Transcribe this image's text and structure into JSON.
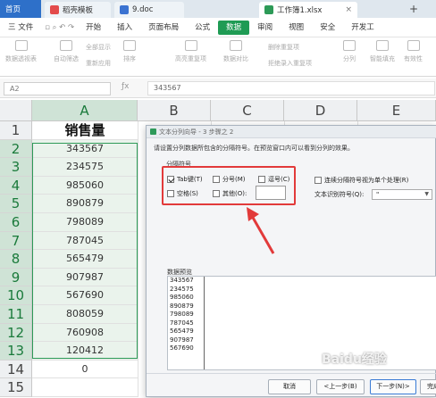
{
  "tabs": {
    "home": "首页",
    "templates": "稻壳模板",
    "doc": "9.doc",
    "workbook": "工作簿1.xlsx",
    "plus": "+"
  },
  "menu": {
    "file": "三 文件",
    "items": [
      "开始",
      "插入",
      "页面布局",
      "公式",
      "数据",
      "审阅",
      "视图",
      "安全",
      "开发工"
    ]
  },
  "ribbon": {
    "btn_pivot": "数据透视表",
    "btn_autofilter": "自动筛选",
    "btn_reapply": "重新应用",
    "btn_showall": "全部显示",
    "btn_sort": "排序",
    "btn_highlight": "高亮重复项",
    "btn_compare": "数据对比",
    "btn_delete_dup": "删除重复项",
    "btn_reject_dup": "拒绝录入重复项",
    "btn_split": "分列",
    "btn_fill": "智能填充",
    "btn_valid": "有效性"
  },
  "formula_bar": {
    "name_box": "A2",
    "fx": "ƒx",
    "value": "343567"
  },
  "sheet": {
    "columns": [
      "A",
      "B",
      "C",
      "D",
      "E"
    ],
    "rows": [
      "1",
      "2",
      "3",
      "4",
      "5",
      "6",
      "7",
      "8",
      "9",
      "10",
      "11",
      "12",
      "13",
      "14",
      "15"
    ],
    "header": "销售量",
    "values": [
      "343567",
      "234575",
      "985060",
      "890879",
      "798089",
      "787045",
      "565479",
      "907987",
      "567690",
      "808059",
      "760908",
      "120412",
      "0"
    ]
  },
  "dialog": {
    "title": "文本分列向导 - 3 步骤之 2",
    "instruction": "请设置分列数据所包含的分隔符号。在预览窗口内可以看到分列的效果。",
    "group_label": "分隔符号",
    "opt_tab": "Tab键(T)",
    "opt_semicolon": "分号(M)",
    "opt_comma": "逗号(C)",
    "opt_space": "空格(S)",
    "opt_other": "其他(O):",
    "opt_consecutive": "连续分隔符号视为单个处理(R)",
    "qualifier_label": "文本识别符号(Q):",
    "qualifier_value": "\"",
    "preview_label": "数据预览",
    "preview_values": [
      "343567",
      "234575",
      "985060",
      "890879",
      "798089",
      "787045",
      "565479",
      "907987",
      "567690"
    ],
    "btn_cancel": "取消",
    "btn_back": "<上一步(B)",
    "btn_next": "下一步(N)>",
    "btn_finish": "完成"
  },
  "watermark": "Baidu经验",
  "colors": {
    "accent_green": "#2d9a57",
    "highlight_red": "#e23a3a",
    "tab_blue": "#2e70c9"
  }
}
